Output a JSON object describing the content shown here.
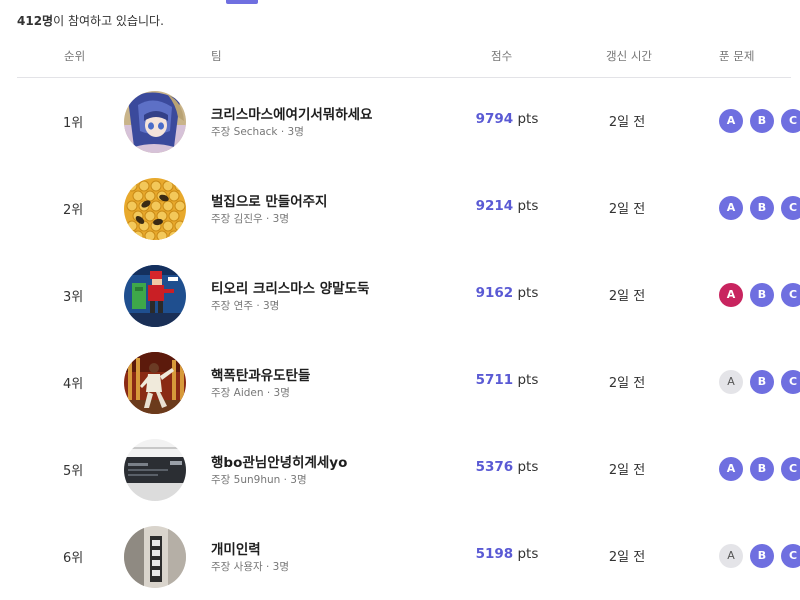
{
  "summary": {
    "count": "412명",
    "rest": "이 참여하고 있습니다."
  },
  "table_header": {
    "rank": "순위",
    "team": "팀",
    "score": "점수",
    "updated": "갱신 시간",
    "problems": "푼 문제"
  },
  "rows": [
    {
      "rank": "1위",
      "name": "크리스마스에여기서뭐하세요",
      "meta": "주장 Sechack · 3명",
      "score": "9794",
      "unit": "pts",
      "time": "2일 전",
      "badges": [
        {
          "label": "A",
          "state": "solved"
        },
        {
          "label": "B",
          "state": "solved"
        },
        {
          "label": "C",
          "state": "solved"
        }
      ]
    },
    {
      "rank": "2위",
      "name": "벌집으로 만들어주지",
      "meta": "주장 김진우 · 3명",
      "score": "9214",
      "unit": "pts",
      "time": "2일 전",
      "badges": [
        {
          "label": "A",
          "state": "solved"
        },
        {
          "label": "B",
          "state": "solved"
        },
        {
          "label": "C",
          "state": "solved"
        }
      ]
    },
    {
      "rank": "3위",
      "name": "티오리 크리스마스 양말도둑",
      "meta": "주장 연주 · 3명",
      "score": "9162",
      "unit": "pts",
      "time": "2일 전",
      "badges": [
        {
          "label": "A",
          "state": "first"
        },
        {
          "label": "B",
          "state": "solved"
        },
        {
          "label": "C",
          "state": "solved"
        }
      ]
    },
    {
      "rank": "4위",
      "name": "핵폭탄과유도탄들",
      "meta": "주장 Aiden · 3명",
      "score": "5711",
      "unit": "pts",
      "time": "2일 전",
      "badges": [
        {
          "label": "A",
          "state": "unsolved"
        },
        {
          "label": "B",
          "state": "solved"
        },
        {
          "label": "C",
          "state": "solved"
        }
      ]
    },
    {
      "rank": "5위",
      "name": "행bo관님안녕히계세yo",
      "meta": "주장 5un9hun · 3명",
      "score": "5376",
      "unit": "pts",
      "time": "2일 전",
      "badges": [
        {
          "label": "A",
          "state": "solved"
        },
        {
          "label": "B",
          "state": "solved"
        },
        {
          "label": "C",
          "state": "solved"
        }
      ]
    },
    {
      "rank": "6위",
      "name": "개미인력",
      "meta": "주장 사용자 · 3명",
      "score": "5198",
      "unit": "pts",
      "time": "2일 전",
      "badges": [
        {
          "label": "A",
          "state": "unsolved"
        },
        {
          "label": "B",
          "state": "solved"
        },
        {
          "label": "C",
          "state": "solved"
        }
      ]
    }
  ],
  "colors": {
    "accent": "#6f6fe0",
    "first_blood": "#c8245f",
    "unsolved": "#e4e4e8",
    "score_number": "#5a5ad4"
  },
  "avatar_icons": [
    "anime-girl-avatar",
    "honeycomb-bees-avatar",
    "pixel-santa-thief-avatar",
    "dancing-man-avatar",
    "dark-screenshot-avatar",
    "building-sign-avatar"
  ]
}
